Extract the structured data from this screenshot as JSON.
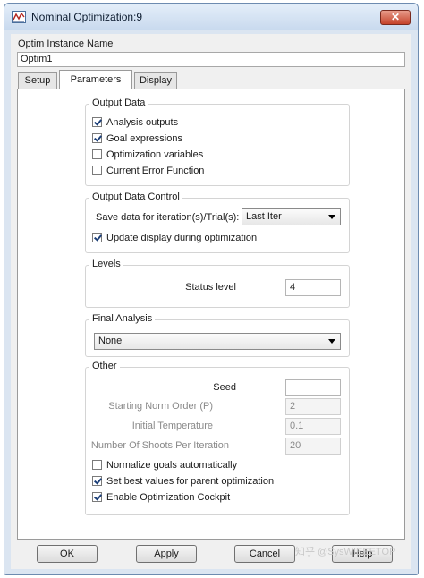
{
  "window": {
    "title": "Nominal Optimization:9",
    "close_glyph": "✕",
    "app_icon": "optim-app-icon"
  },
  "instance": {
    "label": "Optim Instance Name",
    "value": "Optim1"
  },
  "tabs": [
    {
      "label": "Setup",
      "active": false
    },
    {
      "label": "Parameters",
      "active": true
    },
    {
      "label": "Display",
      "active": false
    }
  ],
  "output_data": {
    "title": "Output Data",
    "items": [
      {
        "label": "Analysis outputs",
        "checked": true
      },
      {
        "label": "Goal expressions",
        "checked": true
      },
      {
        "label": "Optimization variables",
        "checked": false
      },
      {
        "label": "Current Error Function",
        "checked": false
      }
    ]
  },
  "output_control": {
    "title": "Output Data Control",
    "save_label": "Save data for iteration(s)/Trial(s):",
    "save_value": "Last Iter",
    "update_label": "Update display during optimization",
    "update_checked": true
  },
  "levels": {
    "title": "Levels",
    "status_label": "Status level",
    "status_value": "4"
  },
  "final_analysis": {
    "title": "Final Analysis",
    "value": "None"
  },
  "other": {
    "title": "Other",
    "seed_label": "Seed",
    "seed_value": "",
    "norm_label": "Starting Norm Order (P)",
    "norm_value": "2",
    "temp_label": "Initial Temperature",
    "temp_value": "0.1",
    "shoots_label": "Number Of Shoots Per Iteration",
    "shoots_value": "20",
    "checks": [
      {
        "label": "Normalize goals automatically",
        "checked": false
      },
      {
        "label": "Set best values for parent optimization",
        "checked": true
      },
      {
        "label": "Enable Optimization Cockpit",
        "checked": true
      }
    ]
  },
  "buttons": {
    "ok": "OK",
    "apply": "Apply",
    "cancel": "Cancel",
    "help": "Help"
  },
  "watermark": "知乎 @SysWIEEETOP",
  "colors": {
    "window_frame": "#dbe5f1",
    "close": "#c5432b",
    "panel": "#ffffff"
  }
}
